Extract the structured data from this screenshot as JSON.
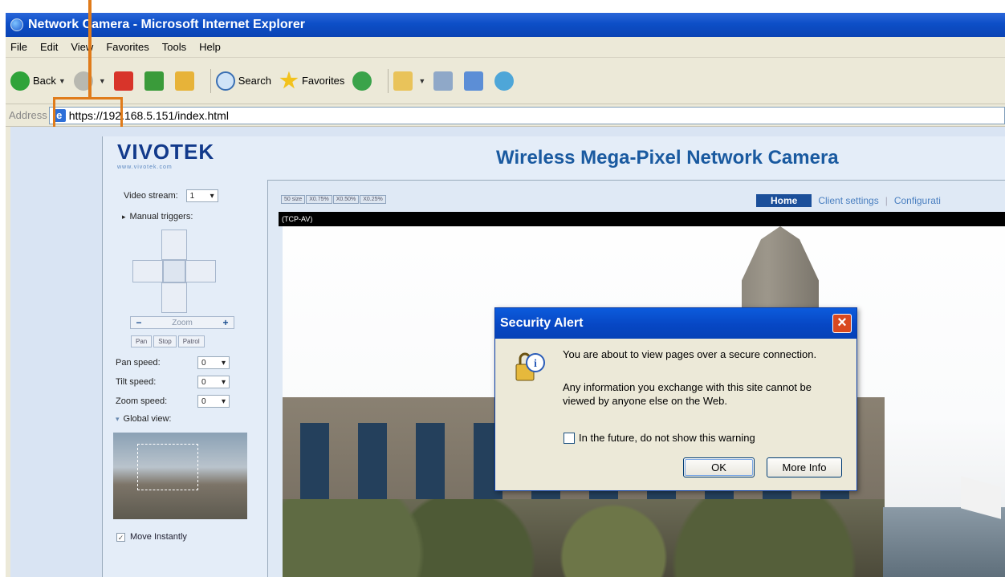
{
  "window": {
    "title": "Network Camera - Microsoft Internet Explorer"
  },
  "menu": [
    "File",
    "Edit",
    "View",
    "Favorites",
    "Tools",
    "Help"
  ],
  "toolbar": {
    "back_label": "Back",
    "search_label": "Search",
    "favorites_label": "Favorites"
  },
  "address": {
    "label": "Address",
    "url": "https://192.168.5.151/index.html"
  },
  "camera_page": {
    "logo": "VIVOTEK",
    "logo_tagline": "www.vivotek.com",
    "title": "Wireless Mega-Pixel Network Camera",
    "video_stream_label": "Video stream:",
    "video_stream_value": "1",
    "manual_triggers": "Manual triggers:",
    "zoom_label": "Zoom",
    "pan_btn": "Pan",
    "stop_btn": "Stop",
    "patrol_btn": "Patrol",
    "pan_speed_label": "Pan speed:",
    "pan_speed_value": "0",
    "tilt_speed_label": "Tilt speed:",
    "tilt_speed_value": "0",
    "zoom_speed_label": "Zoom speed:",
    "zoom_speed_value": "0",
    "global_view_label": "Global view:",
    "move_instantly_label": "Move Instantly",
    "size_buttons": [
      "50 size",
      "X0.75%",
      "X0.50%",
      "X0.25%"
    ],
    "nav": {
      "home": "Home",
      "client_settings": "Client settings",
      "configuration": "Configurati"
    },
    "video_header": "(TCP-AV)"
  },
  "dialog": {
    "title": "Security Alert",
    "line1": "You are about to view pages over a secure connection.",
    "line2": "Any information you exchange with this site cannot be",
    "line3": "viewed by anyone else on the Web.",
    "checkbox_label": "In the future, do not show this warning",
    "ok_label": "OK",
    "more_info_label": "More Info"
  }
}
